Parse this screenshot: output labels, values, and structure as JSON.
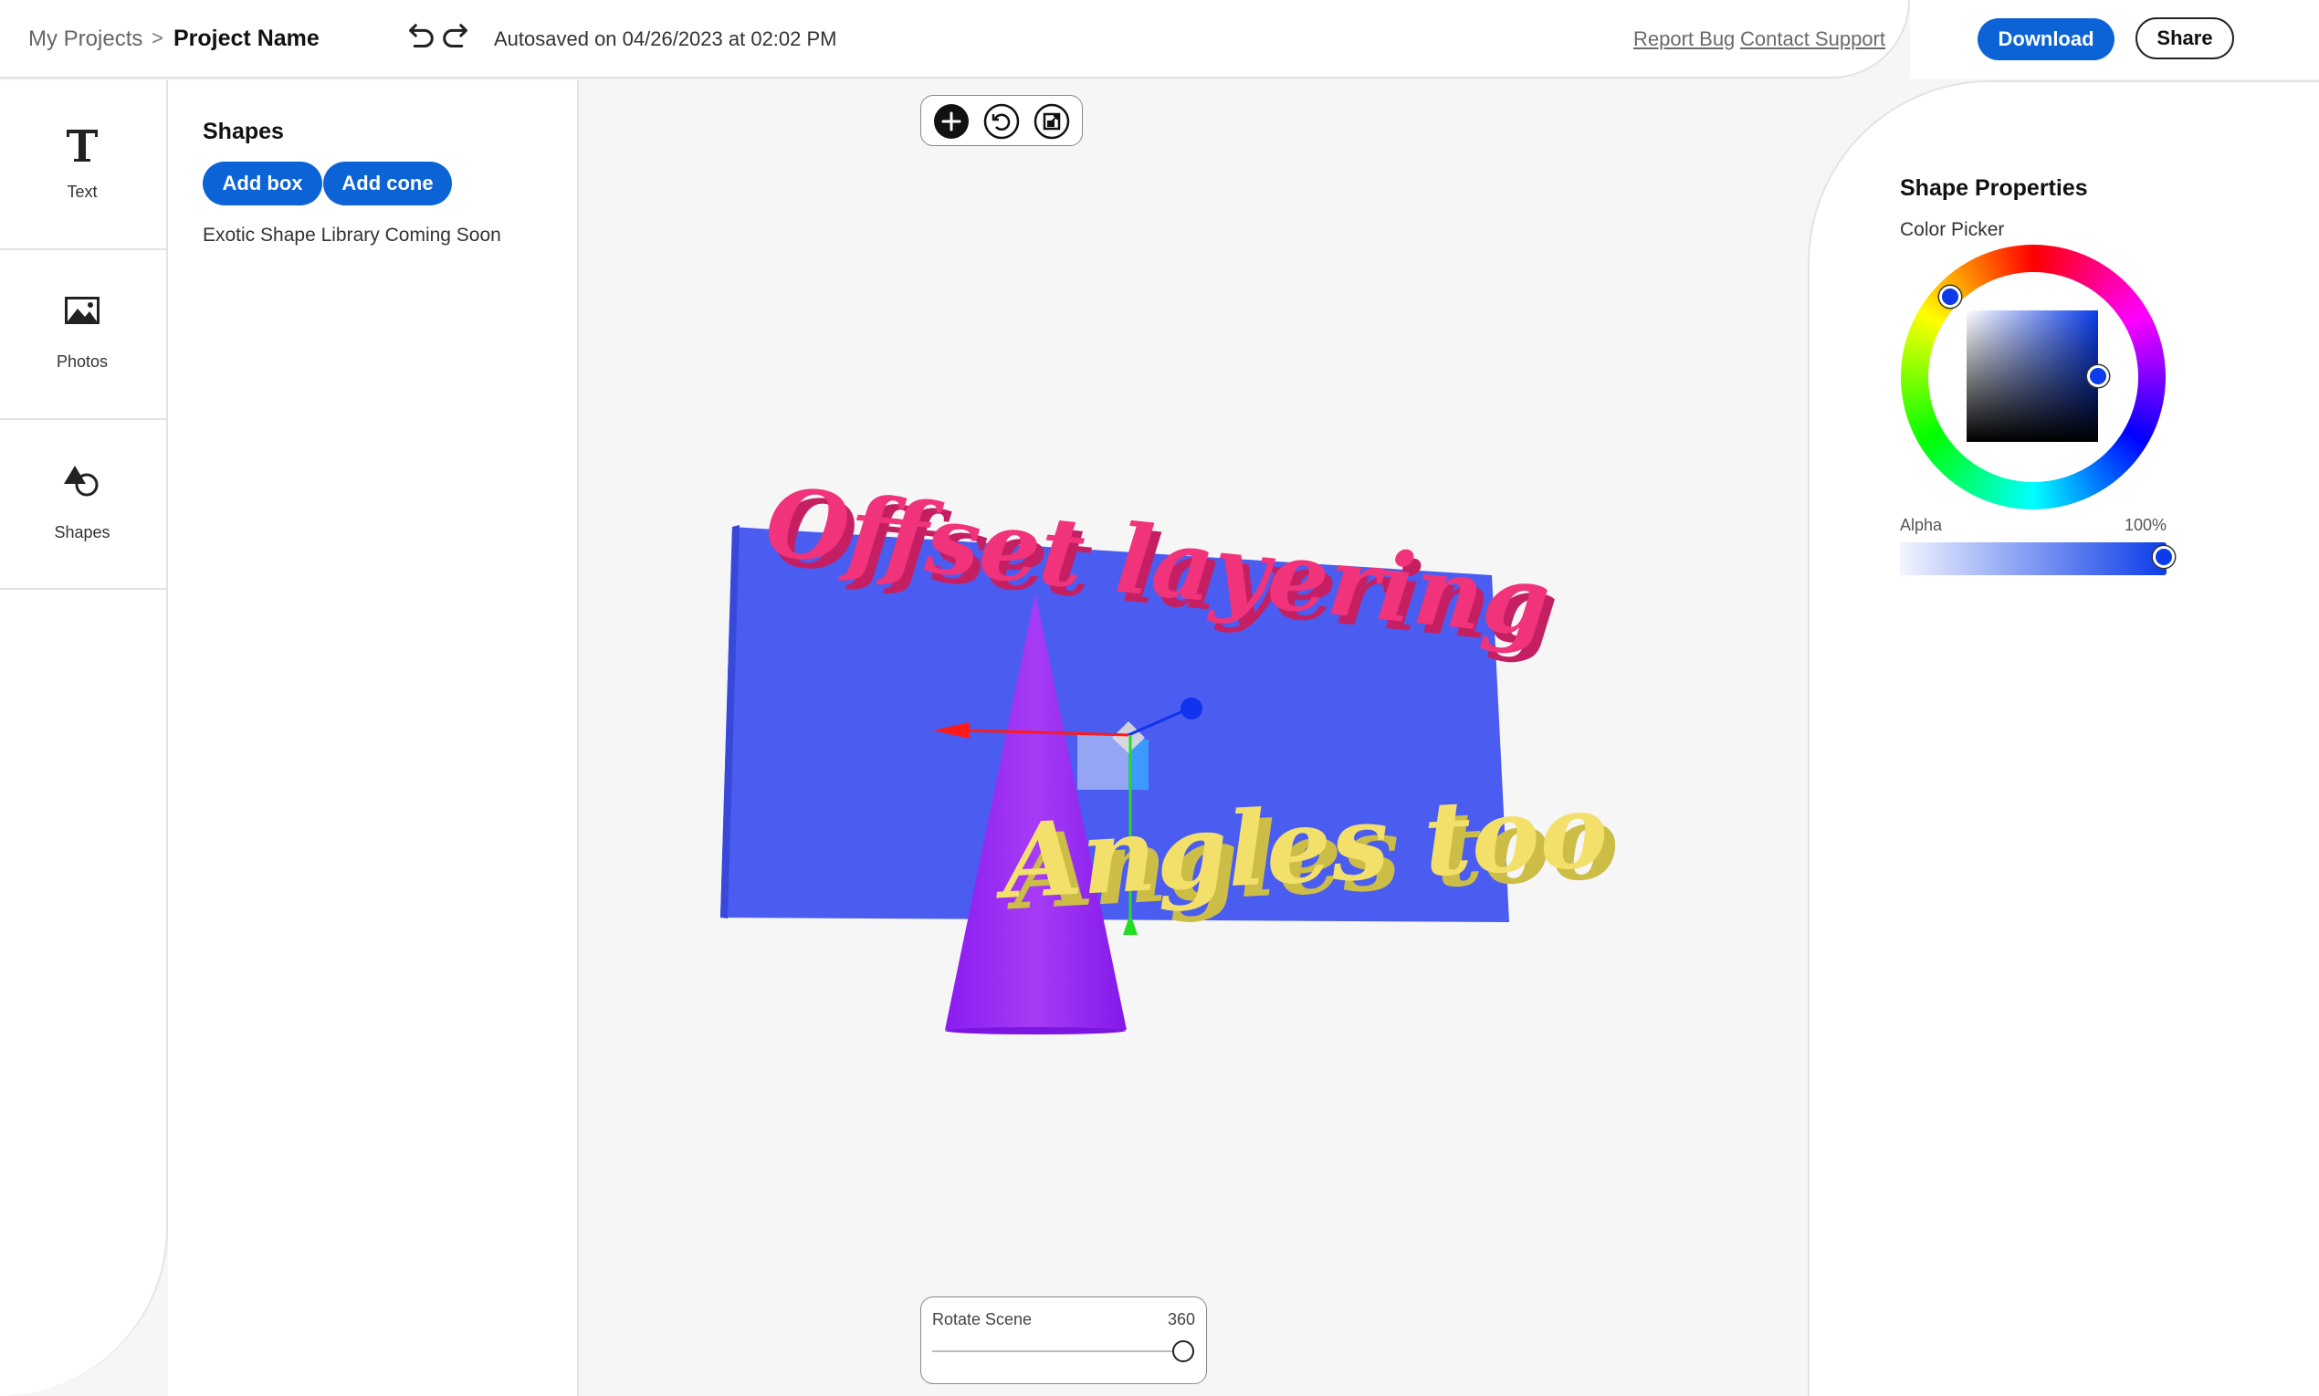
{
  "breadcrumb": {
    "root": "My Projects",
    "separator": ">",
    "current": "Project Name"
  },
  "history": {
    "undo_icon": "undo-icon",
    "redo_icon": "redo-icon"
  },
  "autosave_text": "Autosaved on 04/26/2023 at 02:02 PM",
  "links": {
    "report_bug": "Report Bug",
    "contact_support": "Contact Support"
  },
  "actions": {
    "download": "Download",
    "share": "Share"
  },
  "rail": {
    "items": [
      {
        "label": "Text",
        "icon": "text-icon"
      },
      {
        "label": "Photos",
        "icon": "image-icon"
      },
      {
        "label": "Shapes",
        "icon": "shapes-icon"
      }
    ]
  },
  "shapes_panel": {
    "title": "Shapes",
    "add_box": "Add box",
    "add_cone": "Add cone",
    "note": "Exotic Shape Library Coming Soon"
  },
  "canvas_toolbar": {
    "tools": [
      "add-icon",
      "rotate-icon",
      "scale-icon"
    ]
  },
  "scene": {
    "text_objects": [
      {
        "text": "Offset layering",
        "color": "#f0337a"
      },
      {
        "text": "Angles too",
        "color": "#f2e06a"
      }
    ],
    "plane_color": "#4b5cf0",
    "cone_color": "#9a1ff2",
    "gizmo_colors": {
      "x": "#ff0000",
      "y": "#22dd22",
      "z": "#1133ee"
    }
  },
  "rotate_scene": {
    "label": "Rotate Scene",
    "value": "360",
    "fraction": 1.0
  },
  "properties": {
    "title": "Shape Properties",
    "color_picker_label": "Color Picker",
    "selected_color": "#0b3ce8",
    "alpha_label": "Alpha",
    "alpha_value": "100%"
  },
  "colors": {
    "accent": "#0b63d6"
  }
}
